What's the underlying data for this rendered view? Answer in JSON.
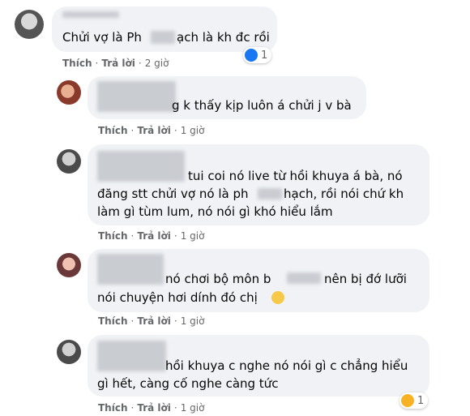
{
  "comments": [
    {
      "lines": [
        "Chửi vợ là Ph",
        "ạch là kh đc rồi"
      ],
      "actions": {
        "like": "Thích",
        "reply": "Trả lời",
        "time": "2 giờ"
      },
      "reaction": {
        "type": "like-icon",
        "count": "1"
      }
    },
    {
      "lines": [
        "g k thấy kịp luôn á chửi j v bà"
      ],
      "actions": {
        "like": "Thích",
        "reply": "Trả lời",
        "time": "1 giờ"
      }
    },
    {
      "lines": [
        "tui coi nó live từ hồi khuya á bà, nó",
        "đăng stt chửi vợ nó là ph",
        "hạch, rồi nói chứ kh",
        "làm gì tùm lum, nó nói gì khó hiểu lắm"
      ],
      "actions": {
        "like": "Thích",
        "reply": "Trả lời",
        "time": "1 giờ"
      }
    },
    {
      "lines": [
        "nó chơi bộ môn b",
        "nên bị đớ lưỡi",
        "nói chuyện hơi dính đó chị"
      ],
      "actions": {
        "like": "Thích",
        "reply": "Trả lời",
        "time": "1 giờ"
      }
    },
    {
      "lines": [
        "hồi khuya c nghe nó nói gì c chẳng hiểu",
        "gì hết, càng cố nghe càng tức"
      ],
      "actions": {
        "like": "Thích",
        "reply": "Trả lời",
        "time": "1 giờ"
      },
      "reaction": {
        "type": "haha-icon",
        "count": "1"
      }
    }
  ]
}
